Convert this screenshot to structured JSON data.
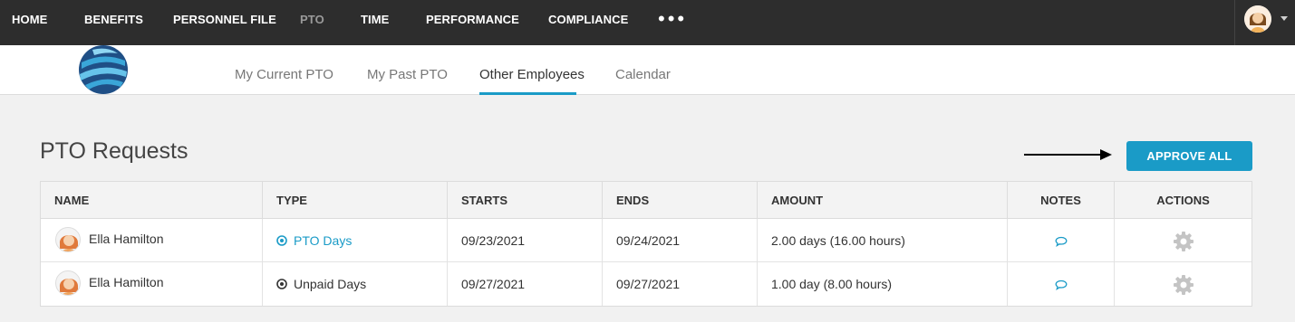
{
  "topnav": {
    "items": [
      {
        "label": "HOME"
      },
      {
        "label": "BENEFITS"
      },
      {
        "label": "PERSONNEL FILE"
      },
      {
        "label": "PTO"
      },
      {
        "label": "TIME"
      },
      {
        "label": "PERFORMANCE"
      },
      {
        "label": "COMPLIANCE"
      }
    ],
    "more": "•••",
    "avatar_icon": "user-avatar-icon"
  },
  "subnav": {
    "logo_icon": "globe-logo",
    "tabs": [
      {
        "label": "My Current PTO"
      },
      {
        "label": "My Past PTO"
      },
      {
        "label": "Other Employees",
        "active": true
      },
      {
        "label": "Calendar"
      }
    ]
  },
  "main": {
    "title": "PTO Requests",
    "approve_all": "APPROVE ALL"
  },
  "table": {
    "headers": {
      "name": "NAME",
      "type": "TYPE",
      "starts": "STARTS",
      "ends": "ENDS",
      "amount": "AMOUNT",
      "notes": "NOTES",
      "actions": "ACTIONS"
    },
    "rows": [
      {
        "name": "Ella Hamilton",
        "type": "PTO Days",
        "starts": "09/23/2021",
        "ends": "09/24/2021",
        "amount": "2.00 days (16.00 hours)"
      },
      {
        "name": "Ella Hamilton",
        "type": "Unpaid Days",
        "starts": "09/27/2021",
        "ends": "09/27/2021",
        "amount": "1.00 day (8.00 hours)"
      }
    ]
  },
  "colors": {
    "topbar": "#2d2d2d",
    "accent": "#1a9bc7",
    "page_bg": "#f1f1f1"
  }
}
